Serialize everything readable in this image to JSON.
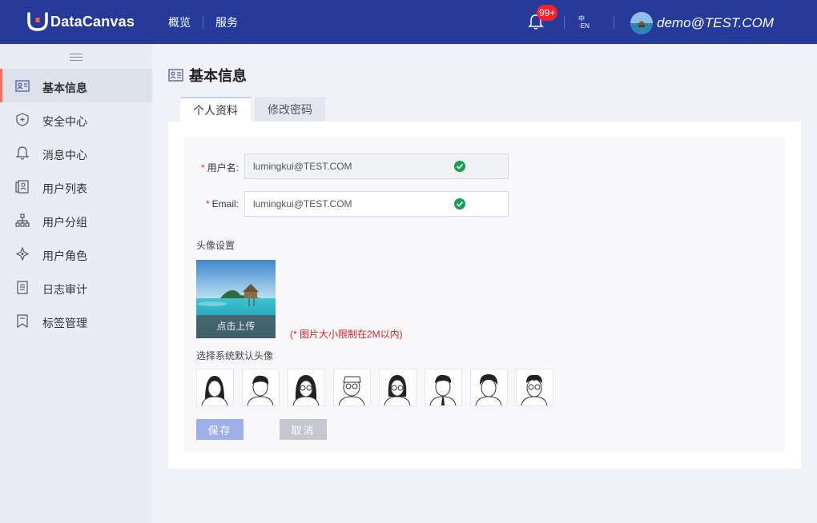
{
  "header": {
    "logo_text": "DataCanvas",
    "nav": [
      "概览",
      "服务"
    ],
    "notification_badge": "99+",
    "lang_zh": "中",
    "lang_en": "EN",
    "user_name": "demo@TEST.COM"
  },
  "sidebar": {
    "items": [
      {
        "label": "基本信息",
        "icon": "profile-card-icon"
      },
      {
        "label": "安全中心",
        "icon": "shield-icon"
      },
      {
        "label": "消息中心",
        "icon": "bell-icon"
      },
      {
        "label": "用户列表",
        "icon": "user-list-icon"
      },
      {
        "label": "用户分组",
        "icon": "org-tree-icon"
      },
      {
        "label": "用户角色",
        "icon": "role-icon"
      },
      {
        "label": "日志审计",
        "icon": "document-icon"
      },
      {
        "label": "标签管理",
        "icon": "bookmark-icon"
      }
    ],
    "active_index": 0
  },
  "main": {
    "title": "基本信息",
    "tabs": [
      {
        "label": "个人资料",
        "active": true
      },
      {
        "label": "修改密码",
        "active": false
      }
    ],
    "form": {
      "username_label": "用户名:",
      "username_value": "lumingkui@TEST.COM",
      "email_label": "Email:",
      "email_value": "lumingkui@TEST.COM",
      "avatar_section": "头像设置",
      "upload_label": "点击上传",
      "size_hint": "(* 图片大小限制在2M以内)",
      "default_avatar_section": "选择系统默认头像",
      "default_avatar_count": 8
    },
    "buttons": {
      "save": "保存",
      "cancel": "取消"
    }
  },
  "colors": {
    "header_bg": "#253a99",
    "active_indicator": "#ff6b57",
    "check_green": "#13a051",
    "save_button": "#9fb0e8",
    "cancel_button": "#c4c7cf",
    "hint_red": "#e02020"
  }
}
